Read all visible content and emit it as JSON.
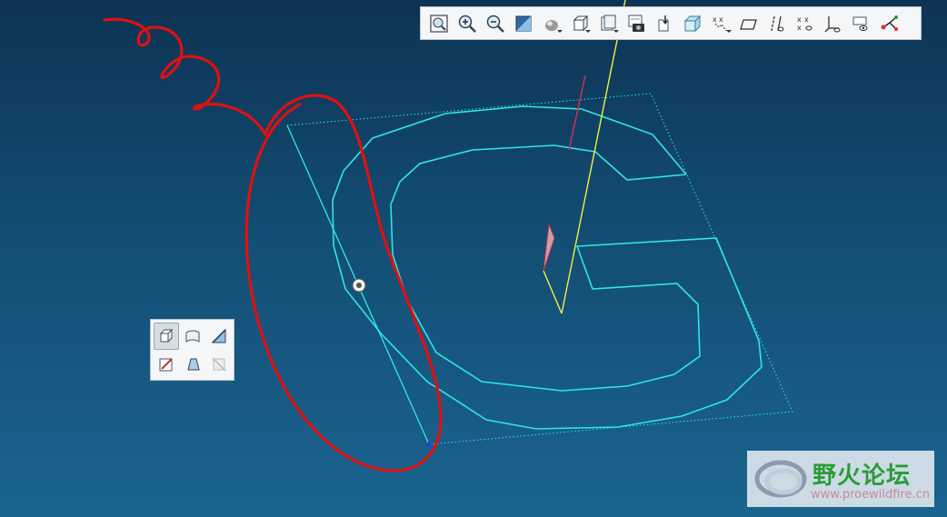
{
  "app": {
    "background_top": "#0d3354",
    "background_bottom": "#1a6490"
  },
  "toolbar": {
    "items": [
      {
        "name": "refit-icon"
      },
      {
        "name": "zoom-in-icon"
      },
      {
        "name": "zoom-out-icon"
      },
      {
        "name": "repaint-icon"
      },
      {
        "name": "display-style-icon"
      },
      {
        "name": "saved-views-icon"
      },
      {
        "name": "view-manager-icon"
      },
      {
        "name": "spin-center-icon"
      },
      {
        "name": "perspective-icon"
      },
      {
        "name": "section-view-icon"
      },
      {
        "name": "plane-display-icon"
      },
      {
        "name": "axis-display-icon"
      },
      {
        "name": "point-display-icon"
      },
      {
        "name": "csys-display-icon"
      },
      {
        "name": "annotation-display-icon"
      },
      {
        "name": "sketch-orient-icon"
      }
    ]
  },
  "mini_toolbar": {
    "items": [
      {
        "name": "solid-icon",
        "active": true
      },
      {
        "name": "surface-icon"
      },
      {
        "name": "cut-icon"
      },
      {
        "name": "sketch-icon"
      },
      {
        "name": "thicken-icon"
      },
      {
        "name": "hide-icon"
      }
    ]
  },
  "watermark": {
    "title": "野火论坛",
    "url": "www.proewildfire.cn",
    "title_color": "#2a9c37"
  },
  "colors": {
    "sketch": "#2ee6e6",
    "annotation": "#e01010",
    "axis": "#f0f040",
    "selected_edge": "#c83050"
  }
}
